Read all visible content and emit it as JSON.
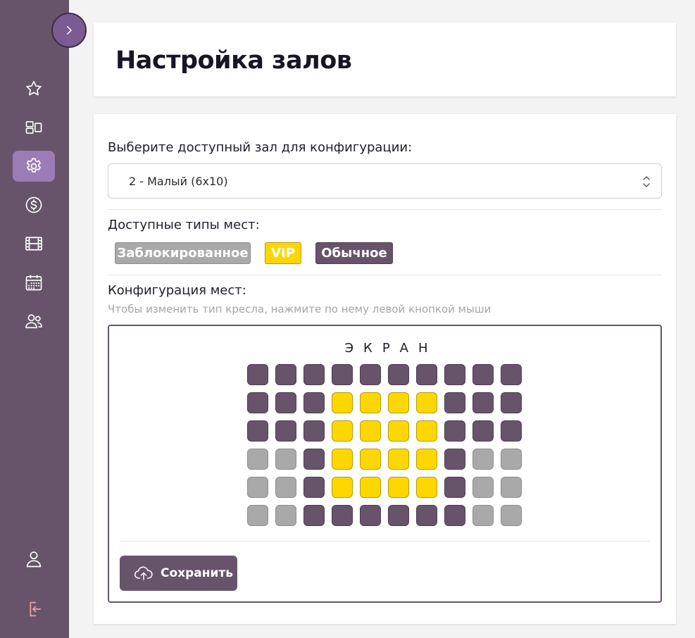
{
  "colors": {
    "sidebar": "#67546b",
    "accent": "#67546b",
    "vip": "#ffd700",
    "blocked": "#a9a9a9",
    "active_nav": "#9c7cb7",
    "logout": "#e8a0a8"
  },
  "sidebar": {
    "toggle_icon": "chevron-right-icon",
    "items": [
      {
        "icon": "star-icon",
        "active": false
      },
      {
        "icon": "layout-icon",
        "active": false
      },
      {
        "icon": "gear-icon",
        "active": true
      },
      {
        "icon": "dollar-icon",
        "active": false
      },
      {
        "icon": "film-icon",
        "active": false
      },
      {
        "icon": "calendar-icon",
        "active": false
      },
      {
        "icon": "users-icon",
        "active": false
      }
    ],
    "bottom": [
      {
        "icon": "user-icon"
      },
      {
        "icon": "logout-icon"
      }
    ]
  },
  "page": {
    "title": "Настройка залов"
  },
  "hall_select": {
    "label": "Выберите доступный зал для конфигурации:",
    "value": "2 - Малый (6x10)"
  },
  "seat_types": {
    "label": "Доступные типы мест:",
    "items": [
      {
        "key": "blocked",
        "label": "Заблокированное"
      },
      {
        "key": "vip",
        "label": "VIP"
      },
      {
        "key": "regular",
        "label": "Обычное"
      }
    ]
  },
  "configuration": {
    "label": "Конфигурация мест:",
    "hint": "Чтобы изменить тип кресла, нажмите по нему левой кнопкой мыши",
    "screen_label": "ЭКРАН",
    "rows": [
      [
        "regular",
        "regular",
        "regular",
        "regular",
        "regular",
        "regular",
        "regular",
        "regular",
        "regular",
        "regular"
      ],
      [
        "regular",
        "regular",
        "regular",
        "vip",
        "vip",
        "vip",
        "vip",
        "regular",
        "regular",
        "regular"
      ],
      [
        "regular",
        "regular",
        "regular",
        "vip",
        "vip",
        "vip",
        "vip",
        "regular",
        "regular",
        "regular"
      ],
      [
        "blocked",
        "blocked",
        "regular",
        "vip",
        "vip",
        "vip",
        "vip",
        "regular",
        "blocked",
        "blocked"
      ],
      [
        "blocked",
        "blocked",
        "regular",
        "vip",
        "vip",
        "vip",
        "vip",
        "regular",
        "blocked",
        "blocked"
      ],
      [
        "blocked",
        "blocked",
        "regular",
        "regular",
        "regular",
        "regular",
        "regular",
        "regular",
        "blocked",
        "blocked"
      ]
    ],
    "save_label": "Сохранить"
  }
}
